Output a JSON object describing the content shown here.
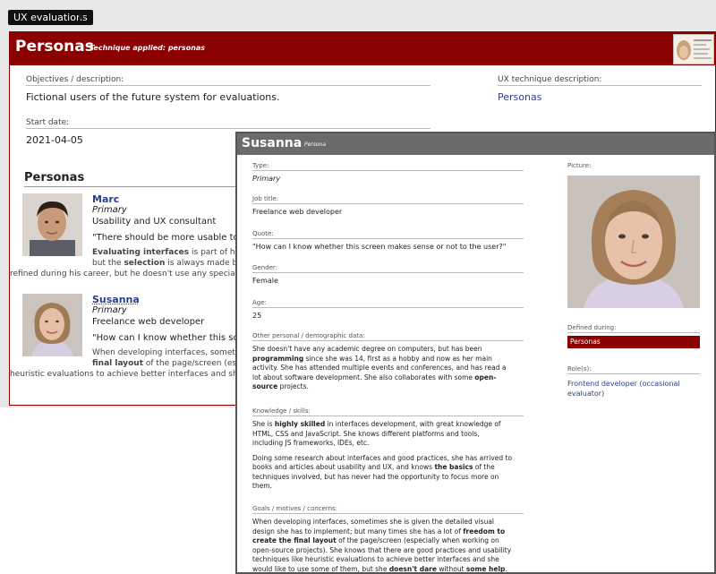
{
  "breadcrumb": "UX evaluations",
  "panel": {
    "title": "Personas",
    "subtitle": "Technique applied: personas",
    "objectives_label": "Objectives / description:",
    "objectives_value": "Fictional users of the future system for evaluations.",
    "technique_label": "UX technique description:",
    "technique_value": "Personas",
    "start_label": "Start date:",
    "start_value": "2021-04-05",
    "personas_heading": "Personas"
  },
  "personas": [
    {
      "name": "Marc",
      "type": "Primary",
      "job": "Usability and UX consultant",
      "quote": "\"There should be more usable tools t",
      "desc_1_bold": "Evaluating interfaces",
      "desc_1_rest": " is part of his d",
      "desc_2_pre": "but the ",
      "desc_2_bold": "selection",
      "desc_2_rest": " is always made bas",
      "desc_3": "refined during his career, but he doesn't use any speciali"
    },
    {
      "name": "Susanna",
      "type": "Primary",
      "job": "Freelance web developer",
      "quote": "\"How can I know whether this screen",
      "desc_1": "When developing interfaces, sometime",
      "desc_2_bold": "final layout",
      "desc_2_rest": " of the page/screen (espe",
      "desc_3": "heuristic evaluations to achieve better interfaces and she"
    }
  ],
  "modal": {
    "title": "Susanna",
    "subtitle": "Persona",
    "type_label": "Type:",
    "type_value": "Primary",
    "job_label": "Job title:",
    "job_value": "Freelance web developer",
    "quote_label": "Quote:",
    "quote_value": "\"How can I know whether this screen makes sense or not to the user?\"",
    "gender_label": "Gender:",
    "gender_value": "Female",
    "age_label": "Age:",
    "age_value": "25",
    "demo_label": "Other personal / demographic data:",
    "demo_1": "She doesn't have any academic degree on computers, but has been",
    "demo_2_bold": "programming",
    "demo_2_rest": " since she was 14, first as a hobby and now as her main",
    "demo_3": "activity. She has attended multiple events and conferences, and has read a",
    "demo_4_pre": "lot about software development. She also collaborates with some ",
    "demo_4_bold": "open-",
    "demo_5_bold": "source",
    "demo_5_rest": " projects.",
    "skills_label": "Knowledge / skills:",
    "skills_1_pre": "She is ",
    "skills_1_bold": "highly skilled",
    "skills_1_rest": " in interfaces development, with great knowledge of",
    "skills_2": "HTML, CSS and JavaScript. She knows different platforms and tools,",
    "skills_3": "including JS frameworks, IDEs, etc.",
    "skills_4": "Doing some research about interfaces and good practices, she has arrived to",
    "skills_5_pre": "books and articles about usability and UX, and knows ",
    "skills_5_bold": "the basics",
    "skills_5_rest": " of the",
    "skills_6": "techniques involved, but has never had the opportunity to focus more on",
    "skills_7": "them.",
    "goals_label": "Goals / motives / concerns:",
    "goals_1": "When developing interfaces, sometimes she is given the detailed visual",
    "goals_2_pre": "design she has to implement; but many times she has a lot of ",
    "goals_2_bold": "freedom to",
    "goals_3_bold": "create the final layout",
    "goals_3_rest": " of the page/screen (especially when working on",
    "goals_4": "open-source projects). She knows that there are good practices and usability",
    "goals_5": "techniques like heuristic evaluations to achieve better interfaces and she",
    "goals_6_pre": "would like to use some of them, but she ",
    "goals_6_bold1": "doesn't dare",
    "goals_6_mid": " without ",
    "goals_6_bold2": "some help",
    "goals_6_end": ".",
    "picture_label": "Picture:",
    "defined_label": "Defined during:",
    "defined_value": "Personas",
    "roles_label": "Role(s):",
    "roles_value_1": "Frontend developer (occasional",
    "roles_value_2": "evaluator)"
  },
  "icons": [
    "breadcrumb-arrow-icon"
  ],
  "colors": {
    "header_red": "#8b0000",
    "modal_header": "#6b6b6b",
    "link_blue": "#2a3f8f"
  }
}
